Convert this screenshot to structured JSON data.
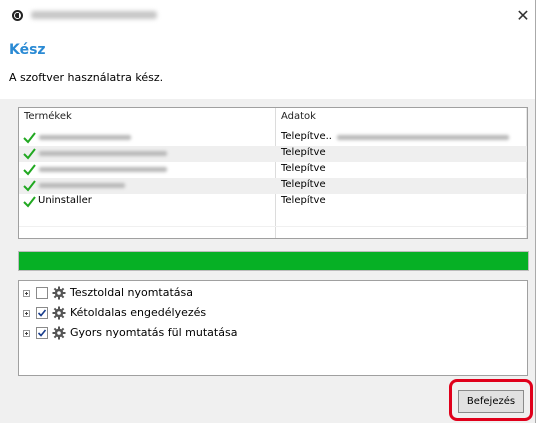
{
  "window": {
    "close_glyph": "✕"
  },
  "header": {
    "heading": "Kész",
    "subtitle": "A szoftver használatra kész."
  },
  "products": {
    "columns": [
      "Termékek",
      "Adatok"
    ],
    "rows": [
      {
        "name": "",
        "status": "Telepítve.."
      },
      {
        "name": "",
        "status": "Telepítve"
      },
      {
        "name": "",
        "status": "Telepítve"
      },
      {
        "name": "",
        "status": "Telepítve"
      },
      {
        "name": "Uninstaller",
        "status": "Telepítve"
      }
    ]
  },
  "progress": {
    "percent": 100,
    "color": "#06b025"
  },
  "features": [
    {
      "label": "Tesztoldal nyomtatása",
      "checked": false
    },
    {
      "label": "Kétoldalas engedélyezés",
      "checked": true
    },
    {
      "label": "Gyors nyomtatás fül mutatása",
      "checked": true
    }
  ],
  "footer": {
    "finish_label": "Befejezés"
  },
  "colors": {
    "accent": "#2a8ad4",
    "highlight": "#e0001b",
    "check": "#21a821"
  },
  "icons": {
    "row_status": "checkmark-icon",
    "feature": "gear-icon",
    "app": "app-icon"
  }
}
